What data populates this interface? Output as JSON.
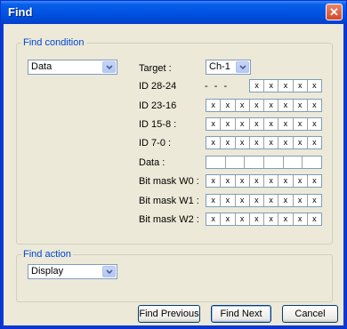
{
  "window": {
    "title": "Find"
  },
  "find_condition": {
    "legend": "Find condition",
    "type_value": "Data",
    "target_label": "Target :",
    "target_value": "Ch-1",
    "rows": [
      {
        "label": "ID 28-24",
        "prefix": "- - -",
        "cells": [
          "x",
          "x",
          "x",
          "x",
          "x"
        ]
      },
      {
        "label": "ID 23-16",
        "cells": [
          "x",
          "x",
          "x",
          "x",
          "x",
          "x",
          "x",
          "x"
        ]
      },
      {
        "label": "ID 15-8 :",
        "cells": [
          "x",
          "x",
          "x",
          "x",
          "x",
          "x",
          "x",
          "x"
        ]
      },
      {
        "label": "ID 7-0 :",
        "cells": [
          "x",
          "x",
          "x",
          "x",
          "x",
          "x",
          "x",
          "x"
        ]
      },
      {
        "label": "Data :",
        "cells": [
          "",
          "",
          "",
          "",
          "",
          ""
        ]
      },
      {
        "label": "Bit mask W0 :",
        "cells": [
          "x",
          "x",
          "x",
          "x",
          "x",
          "x",
          "x",
          "x"
        ]
      },
      {
        "label": "Bit mask W1 :",
        "cells": [
          "x",
          "x",
          "x",
          "x",
          "x",
          "x",
          "x",
          "x"
        ]
      },
      {
        "label": "Bit mask W2 :",
        "cells": [
          "x",
          "x",
          "x",
          "x",
          "x",
          "x",
          "x",
          "x"
        ]
      }
    ]
  },
  "find_action": {
    "legend": "Find action",
    "value": "Display"
  },
  "buttons": {
    "find_previous": "Find Previous",
    "find_next": "Find Next",
    "cancel": "Cancel"
  }
}
